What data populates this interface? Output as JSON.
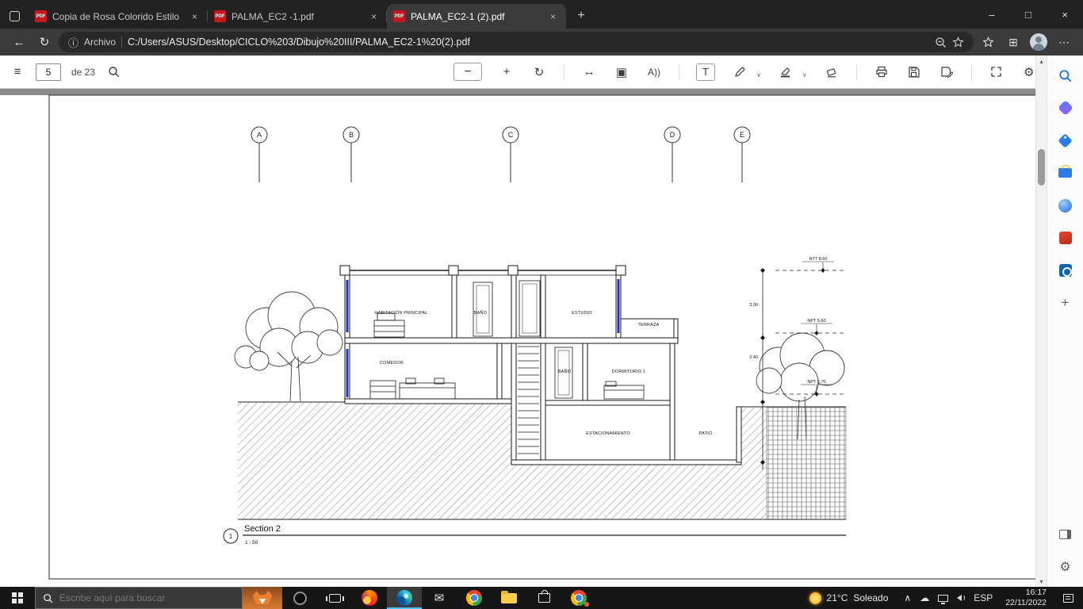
{
  "browser": {
    "tab_list": [
      {
        "title": "Copia de Rosa Colorido Estilo Se"
      },
      {
        "title": "PALMA_EC2 -1.pdf"
      },
      {
        "title": "PALMA_EC2-1 (2).pdf"
      }
    ],
    "address": {
      "scheme_label": "Archivo",
      "url": "C:/Users/ASUS/Desktop/CICLO%203/Dibujo%20III/PALMA_EC2-1%20(2).pdf"
    },
    "pdf_toolbar": {
      "page": "5",
      "page_count": "de 23"
    }
  },
  "icons": {
    "pdf_badge": "PDF",
    "tab_close": "×",
    "new_tab": "+",
    "minimize": "–",
    "maximize": "□",
    "close": "×",
    "back": "←",
    "refresh": "↻",
    "info": "ⓘ",
    "collections": "⊞",
    "more": "⋯",
    "toc": "≡",
    "zoom_out": "−",
    "zoom_in": "+",
    "rotate": "↻",
    "fit_width": "↔",
    "page_view": "▣",
    "read_aloud": "A))",
    "add_text": "T",
    "dropdown": "∨",
    "gear": "⚙",
    "plus": "+",
    "caret_up": "∧",
    "cloud": "☁",
    "envelope": "✉",
    "scroll_up": "▴",
    "scroll_down": "▾"
  },
  "drawing": {
    "grid": [
      "A",
      "B",
      "C",
      "D",
      "E"
    ],
    "rooms": {
      "habitacion": "HABITACIÓN PRINCIPAL",
      "bano_upper": "BAÑO",
      "estudio": "ESTUDIO",
      "terraza": "TERRAZA",
      "comedor": "COMEDOR",
      "bano_lower": "BAÑO",
      "dormitorio": "DORMITORIO 1",
      "estacionamiento": "ESTACIONAMIENTO",
      "patio": "PATIO"
    },
    "levels": {
      "roof": "NTT 8.60",
      "upper": "NPT 5.60",
      "ground": "NPT 2.70"
    },
    "dimensions": {
      "upper_height": "3.00",
      "lower_height": "2.40"
    },
    "title": {
      "marker": "1",
      "name": "Section 2",
      "scale": "1 : 50"
    }
  },
  "taskbar": {
    "search_placeholder": "Escribe aquí para buscar",
    "weather_temp": "21°C",
    "weather_condition": "Soleado",
    "language": "ESP",
    "time": "16:17",
    "date": "22/11/2022"
  }
}
